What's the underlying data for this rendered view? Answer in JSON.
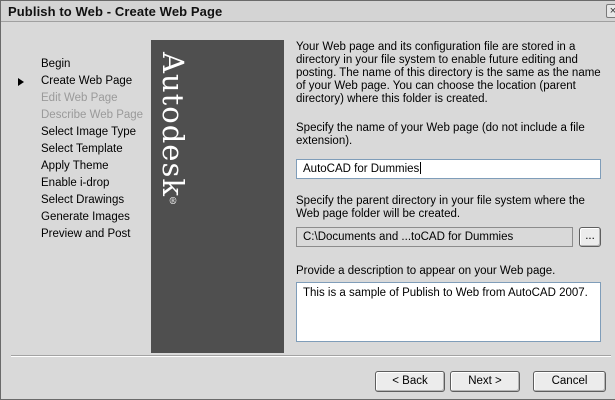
{
  "window": {
    "title": "Publish to Web - Create Web Page",
    "close_glyph": "×"
  },
  "steps": [
    {
      "label": "Begin",
      "state": "normal"
    },
    {
      "label": "Create Web Page",
      "state": "current"
    },
    {
      "label": "Edit Web Page",
      "state": "disabled"
    },
    {
      "label": "Describe Web Page",
      "state": "disabled"
    },
    {
      "label": "Select Image Type",
      "state": "normal"
    },
    {
      "label": "Select Template",
      "state": "normal"
    },
    {
      "label": "Apply Theme",
      "state": "normal"
    },
    {
      "label": "Enable i-drop",
      "state": "normal"
    },
    {
      "label": "Select Drawings",
      "state": "normal"
    },
    {
      "label": "Generate Images",
      "state": "normal"
    },
    {
      "label": "Preview and Post",
      "state": "normal"
    }
  ],
  "brand": {
    "logo_text": "Autodesk",
    "mark": "®",
    "panel_color": "#4f4f4f"
  },
  "intro": {
    "text": "Your Web page and its configuration file are stored in a directory in your file system to enable future editing and posting.  The name of this directory is the same as the name of your Web page.  You can choose the location (parent directory) where this folder is created."
  },
  "name_field": {
    "label": "Specify the name of your Web page (do not include a file extension).",
    "value": "AutoCAD for Dummies"
  },
  "directory_field": {
    "label": "Specify the parent directory in your file system where the Web page folder will be created.",
    "value": "C:\\Documents and ...toCAD for Dummies",
    "browse_label": "..."
  },
  "description_field": {
    "label": "Provide a description to appear on your Web page.",
    "value": "This is a sample of Publish to Web from AutoCAD 2007."
  },
  "buttons": {
    "back": "< Back",
    "next": "Next >",
    "cancel": "Cancel"
  }
}
